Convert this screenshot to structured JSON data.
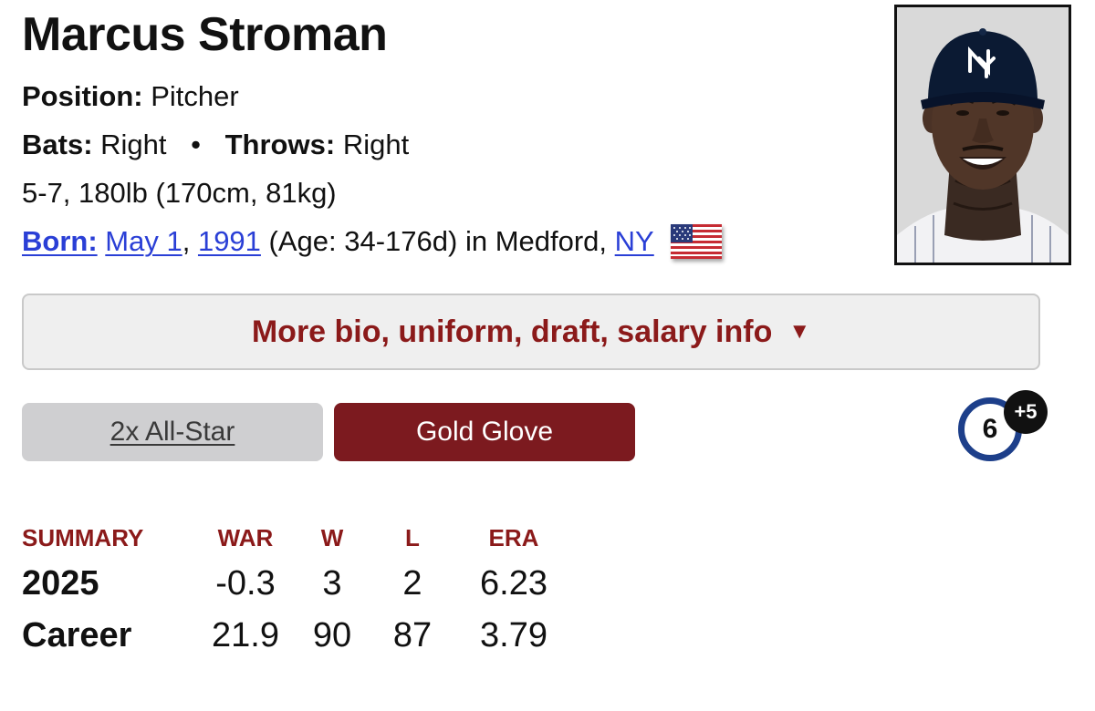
{
  "player": {
    "name": "Marcus Stroman",
    "position_label": "Position:",
    "position": "Pitcher",
    "bats_label": "Bats:",
    "bats": "Right",
    "separator": "•",
    "throws_label": "Throws:",
    "throws": "Right",
    "size": "5-7, 180lb (170cm, 81kg)",
    "born": {
      "label": "Born:",
      "month_day": "May 1",
      "comma": ",",
      "year": "1991",
      "age_text": "(Age: 34-176d) in Medford,",
      "state": "NY",
      "flag_icon": "us-flag-icon"
    }
  },
  "headshot": {
    "icon": "player-headshot",
    "cap_color": "#0b1a33",
    "background": "#d8d8d8"
  },
  "bio_toggle": {
    "label": "More bio, uniform, draft, salary info",
    "caret": "▼"
  },
  "awards": [
    {
      "label": "2x All-Star",
      "style": "gray"
    },
    {
      "label": "Gold Glove",
      "style": "maroon"
    }
  ],
  "more_awards": {
    "count": "6",
    "extra": "+5"
  },
  "summary": {
    "headers": [
      "SUMMARY",
      "WAR",
      "W",
      "L",
      "ERA"
    ],
    "rows": [
      {
        "label": "2025",
        "war": "-0.3",
        "w": "3",
        "l": "2",
        "era": "6.23"
      },
      {
        "label": "Career",
        "war": "21.9",
        "w": "90",
        "l": "87",
        "era": "3.79"
      }
    ]
  },
  "colors": {
    "accent_maroon": "#7c1a1f",
    "header_red": "#8b1a1a",
    "link_blue": "#2a3fd6",
    "badge_ring": "#1d3f8a"
  }
}
